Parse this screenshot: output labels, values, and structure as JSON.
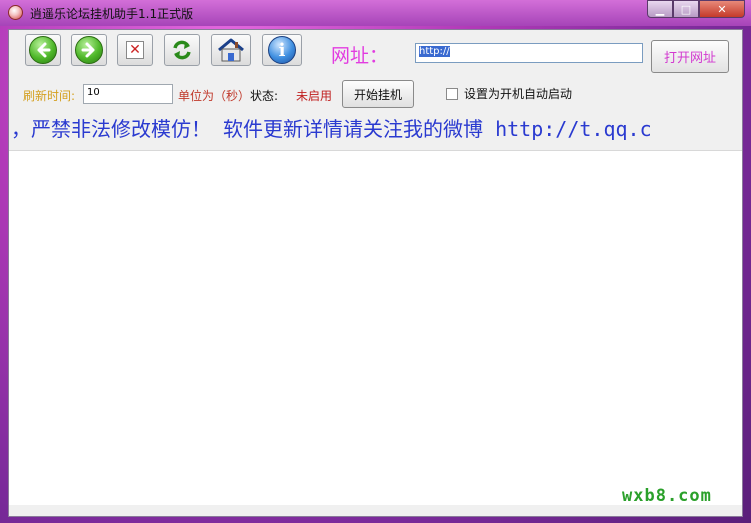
{
  "window": {
    "title": "逍遥乐论坛挂机助手1.1正式版",
    "controls": {
      "minimize": "▁",
      "maximize": "□",
      "close": "✕"
    }
  },
  "toolbar": {
    "icons": [
      "back-arrow-icon",
      "forward-arrow-icon",
      "stop-icon",
      "refresh-icon",
      "home-icon",
      "info-icon"
    ],
    "stop_glyph": "✕",
    "info_glyph": "i",
    "url_label": "网址：",
    "url_value": "http://",
    "open_button": "打开网址"
  },
  "settings": {
    "refresh_label": "刷新时间:",
    "refresh_value": "10",
    "unit_label": "单位为（秒）",
    "status_label": "状态:",
    "status_value": "未启用",
    "start_button": "开始挂机",
    "autostart_label": "设置为开机自动启动",
    "autostart_checked": false
  },
  "marquee": {
    "text": "，严禁非法修改模仿！ 软件更新详情请关注我的微博 http://t.qq.c"
  },
  "watermark": "wxb8.com",
  "colors": {
    "url_label": "#e23ce0",
    "refresh_label": "#d4a020",
    "unit_label": "#c0392b",
    "status_value": "#c02020",
    "marquee": "#2a3ad0",
    "watermark": "#2aa02a"
  }
}
